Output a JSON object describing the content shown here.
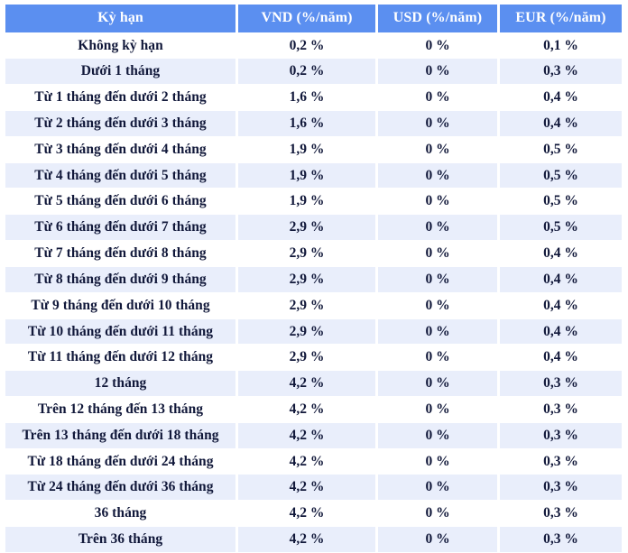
{
  "table": {
    "columns": [
      {
        "key": "term",
        "label": "Kỳ hạn"
      },
      {
        "key": "vnd",
        "label": "VND (%/năm)"
      },
      {
        "key": "usd",
        "label": "USD (%/năm)"
      },
      {
        "key": "eur",
        "label": "EUR (%/năm)"
      }
    ],
    "rows": [
      {
        "term": "Không kỳ hạn",
        "vnd": "0,2 %",
        "usd": "0 %",
        "eur": "0,1 %"
      },
      {
        "term": "Dưới 1 tháng",
        "vnd": "0,2 %",
        "usd": "0 %",
        "eur": "0,3 %"
      },
      {
        "term": "Từ 1 tháng đến dưới 2 tháng",
        "vnd": "1,6 %",
        "usd": "0 %",
        "eur": "0,4 %"
      },
      {
        "term": "Từ 2 tháng đến dưới 3 tháng",
        "vnd": "1,6 %",
        "usd": "0 %",
        "eur": "0,4 %"
      },
      {
        "term": "Từ 3 tháng đến dưới 4 tháng",
        "vnd": "1,9 %",
        "usd": "0 %",
        "eur": "0,5 %"
      },
      {
        "term": "Từ 4 tháng đến dưới 5 tháng",
        "vnd": "1,9 %",
        "usd": "0 %",
        "eur": "0,5 %"
      },
      {
        "term": "Từ 5 tháng đến dưới 6 tháng",
        "vnd": "1,9 %",
        "usd": "0 %",
        "eur": "0,5 %"
      },
      {
        "term": "Từ 6 tháng đến dưới 7 tháng",
        "vnd": "2,9 %",
        "usd": "0 %",
        "eur": "0,5 %"
      },
      {
        "term": "Từ 7 tháng đến dưới 8 tháng",
        "vnd": "2,9 %",
        "usd": "0 %",
        "eur": "0,4 %"
      },
      {
        "term": "Từ 8 tháng đến dưới 9 tháng",
        "vnd": "2,9 %",
        "usd": "0 %",
        "eur": "0,4 %"
      },
      {
        "term": "Từ 9 tháng đến dưới 10 tháng",
        "vnd": "2,9 %",
        "usd": "0 %",
        "eur": "0,4 %"
      },
      {
        "term": "Từ 10 tháng đến dưới 11 tháng",
        "vnd": "2,9 %",
        "usd": "0 %",
        "eur": "0,4 %"
      },
      {
        "term": "Từ 11 tháng đến dưới 12 tháng",
        "vnd": "2,9 %",
        "usd": "0 %",
        "eur": "0,4 %"
      },
      {
        "term": "12 tháng",
        "vnd": "4,2 %",
        "usd": "0 %",
        "eur": "0,3 %"
      },
      {
        "term": "Trên 12 tháng đến 13 tháng",
        "vnd": "4,2 %",
        "usd": "0 %",
        "eur": "0,3 %"
      },
      {
        "term": "Trên 13 tháng đến dưới 18 tháng",
        "vnd": "4,2 %",
        "usd": "0 %",
        "eur": "0,3 %"
      },
      {
        "term": "Từ 18 tháng đến dưới 24 tháng",
        "vnd": "4,2 %",
        "usd": "0 %",
        "eur": "0,3 %"
      },
      {
        "term": "Từ 24 tháng đến dưới 36 tháng",
        "vnd": "4,2 %",
        "usd": "0 %",
        "eur": "0,3 %"
      },
      {
        "term": "36 tháng",
        "vnd": "4,2 %",
        "usd": "0 %",
        "eur": "0,3 %"
      },
      {
        "term": "Trên 36 tháng",
        "vnd": "4,2 %",
        "usd": "0 %",
        "eur": "0,3 %"
      }
    ]
  },
  "colors": {
    "header_background": "#5b8ff0",
    "header_text": "#ffffff",
    "row_alt_background": "#e9eefb",
    "row_background": "#ffffff",
    "body_text": "#11183a"
  }
}
